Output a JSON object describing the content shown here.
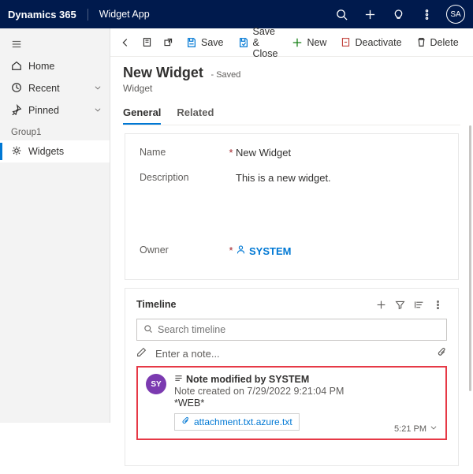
{
  "topnav": {
    "brand": "Dynamics 365",
    "app": "Widget App",
    "avatar": "SA"
  },
  "sidebar": {
    "home": "Home",
    "recent": "Recent",
    "pinned": "Pinned",
    "group_label": "Group1",
    "widgets": "Widgets"
  },
  "commands": {
    "save": "Save",
    "save_close": "Save & Close",
    "new": "New",
    "deactivate": "Deactivate",
    "delete": "Delete"
  },
  "page": {
    "title": "New Widget",
    "saved_suffix": "- Saved",
    "entity": "Widget"
  },
  "tabs": {
    "general": "General",
    "related": "Related"
  },
  "form": {
    "name_label": "Name",
    "name_value": "New Widget",
    "desc_label": "Description",
    "desc_value": "This is a new widget.",
    "owner_label": "Owner",
    "owner_value": "SYSTEM",
    "required_marker": "*"
  },
  "timeline": {
    "title": "Timeline",
    "search_placeholder": "Search timeline",
    "enter_note": "Enter a note...",
    "note": {
      "avatar": "SY",
      "title": "Note modified by SYSTEM",
      "created": "Note created on 7/29/2022 9:21:04 PM",
      "tag": "*WEB*",
      "attachment": "attachment.txt.azure.txt",
      "time": "5:21 PM"
    }
  }
}
